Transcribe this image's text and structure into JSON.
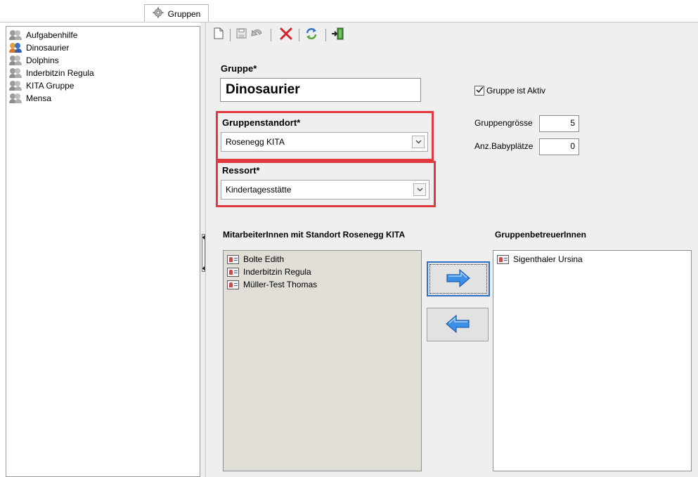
{
  "tab": {
    "label": "Gruppen",
    "icon": "gear-icon"
  },
  "tree": {
    "items": [
      {
        "label": "Aufgabenhilfe",
        "selected": false
      },
      {
        "label": "Dinosaurier",
        "selected": true
      },
      {
        "label": "Dolphins",
        "selected": false
      },
      {
        "label": "Inderbitzin Regula",
        "selected": false
      },
      {
        "label": "KITA Gruppe",
        "selected": false
      },
      {
        "label": "Mensa",
        "selected": false
      }
    ]
  },
  "toolbar": {
    "buttons": [
      "new-document-icon",
      "save-icon",
      "undo-icon",
      "delete-icon",
      "refresh-icon",
      "exit-icon"
    ]
  },
  "form": {
    "gruppe_label": "Gruppe*",
    "gruppe_value": "Dinosaurier",
    "aktiv_label": "Gruppe ist Aktiv",
    "aktiv_checked": true,
    "standort_label": "Gruppenstandort*",
    "standort_value": "Rosenegg KITA",
    "ressort_label": "Ressort*",
    "ressort_value": "Kindertagesstätte",
    "groesse_label": "Gruppengrösse",
    "groesse_value": "5",
    "baby_label": "Anz.Babyplätze",
    "baby_value": "0"
  },
  "lists": {
    "mitarbeiter_label": "MitarbeiterInnen mit Standort Rosenegg KITA",
    "mitarbeiter": [
      "Bolte Edith",
      "Inderbitzin Regula",
      "Müller-Test Thomas"
    ],
    "betreuer_label": "GruppenbetreuerInnen",
    "betreuer": [
      "Sigenthaler Ursina"
    ]
  },
  "colors": {
    "highlight_border": "#e0393e",
    "arrow_blue": "#3c8fe6",
    "delete_red": "#d9232a"
  }
}
